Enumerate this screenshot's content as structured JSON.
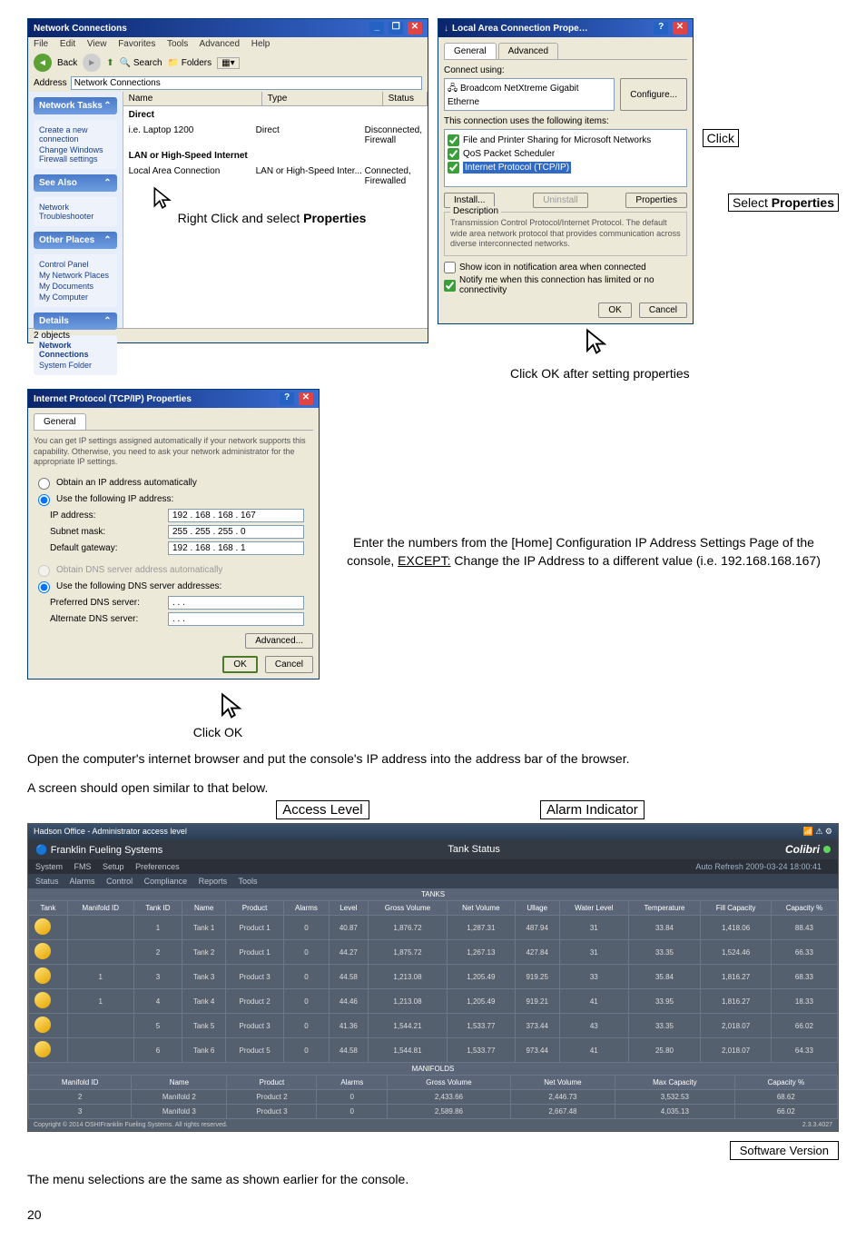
{
  "nc_window": {
    "title": "Network Connections",
    "menu": [
      "File",
      "Edit",
      "View",
      "Favorites",
      "Tools",
      "Advanced",
      "Help"
    ],
    "toolbar": {
      "back": "Back",
      "search": "Search",
      "folders": "Folders"
    },
    "address_label": "Address",
    "address_value": "Network Connections",
    "sidebar": {
      "tasks_title": "Network Tasks",
      "tasks": [
        "Create a new connection",
        "Change Windows Firewall settings"
      ],
      "seealso_title": "See Also",
      "seealso": [
        "Network Troubleshooter"
      ],
      "other_title": "Other Places",
      "other": [
        "Control Panel",
        "My Network Places",
        "My Documents",
        "My Computer"
      ],
      "details_title": "Details",
      "details": [
        "Network Connections",
        "System Folder"
      ]
    },
    "cols": [
      "Name",
      "Type",
      "Status"
    ],
    "group1": "Direct",
    "row1": {
      "name": "i.e. Laptop 1200",
      "type": "Direct",
      "status": "Disconnected, Firewall"
    },
    "group2": "LAN or High-Speed Internet",
    "row2": {
      "name": "Local Area Connection",
      "type": "LAN or High-Speed Inter...",
      "status": "Connected, Firewalled"
    },
    "status": "2 objects"
  },
  "annot": {
    "right_click": "Right Click and select ",
    "prop_bold": "Properties",
    "click": "Click",
    "select_prop": "Select ",
    "click_ok_after": "Click OK after setting properties",
    "click_ok": "Click OK",
    "enter_para": "Enter the numbers from the [Home] Configuration IP Address Settings Page of the console, ",
    "except": "EXCEPT:",
    "enter_para2": " Change the IP Address to a different value (i.e. 192.168.168.167)"
  },
  "props": {
    "title": "Local Area Connection Prope…",
    "tab_general": "General",
    "tab_adv": "Advanced",
    "connect_using_label": "Connect using:",
    "adapter": "Broadcom NetXtreme Gigabit Etherne",
    "configure": "Configure...",
    "uses_label": "This connection uses the following items:",
    "item1": "File and Printer Sharing for Microsoft Networks",
    "item2": "QoS Packet Scheduler",
    "item3": "Internet Protocol (TCP/IP)",
    "install": "Install...",
    "uninstall": "Uninstall",
    "properties": "Properties",
    "desc_head": "Description",
    "desc": "Transmission Control Protocol/Internet Protocol. The default wide area network protocol that provides communication across diverse interconnected networks.",
    "chk1": "Show icon in notification area when connected",
    "chk2": "Notify me when this connection has limited or no connectivity",
    "ok": "OK",
    "cancel": "Cancel"
  },
  "tcpip": {
    "title": "Internet Protocol (TCP/IP) Properties",
    "tab": "General",
    "intro": "You can get IP settings assigned automatically if your network supports this capability. Otherwise, you need to ask your network administrator for the appropriate IP settings.",
    "r1": "Obtain an IP address automatically",
    "r2": "Use the following IP address:",
    "ip_label": "IP address:",
    "ip": "192 . 168 . 168 . 167",
    "mask_label": "Subnet mask:",
    "mask": "255 . 255 . 255 . 0",
    "gate_label": "Default gateway:",
    "gate": "192 . 168 . 168 . 1",
    "r3": "Obtain DNS server address automatically",
    "r4": "Use the following DNS server addresses:",
    "pdns": "Preferred DNS server:",
    "pdns_v": " .   .   . ",
    "adns": "Alternate DNS server:",
    "adns_v": " .   .   . ",
    "adv": "Advanced...",
    "ok": "OK",
    "cancel": "Cancel"
  },
  "body_text": {
    "p1": "Open the computer's internet browser and put the console's IP address into the address bar of the browser.",
    "p2": "A screen should open similar to that below.",
    "p3": "The menu selections are the same as shown earlier for the console.",
    "access": "Access Level",
    "alarm": "Alarm Indicator",
    "sv": "Software Version",
    "page": "20"
  },
  "web": {
    "hdr_left": "Franklin Fueling Systems",
    "hdr_right": "Tank Status",
    "brand": "Colibri",
    "user_line": "Hadson Office - Administrator access level",
    "right_info": "Auto Refresh  2009-03-24 18:00:41",
    "menu": [
      "System",
      "FMS",
      "Setup",
      "Preferences"
    ],
    "submenu": [
      "Status",
      "Alarms",
      "Control",
      "Compliance",
      "Reports",
      "Tools"
    ],
    "tanks_title": "TANKS",
    "cols": [
      "Tank",
      "Manifold ID",
      "Tank ID",
      "Name",
      "Product",
      "Alarms",
      "Level",
      "Gross Volume",
      "Net Volume",
      "Ullage",
      "Water Level",
      "Temperature",
      "Fill Capacity",
      "Capacity %"
    ],
    "rows": [
      [
        "",
        "",
        "1",
        "Tank 1",
        "Product 1",
        "0",
        "40.87",
        "1,876.72",
        "1,287.31",
        "487.94",
        "31",
        "33.84",
        "1,418.06",
        "88.43"
      ],
      [
        "",
        "",
        "2",
        "Tank 2",
        "Product 1",
        "0",
        "44.27",
        "1,875.72",
        "1,267.13",
        "427.84",
        "31",
        "33.35",
        "1,524.46",
        "66.33"
      ],
      [
        "",
        "1",
        "3",
        "Tank 3",
        "Product 3",
        "0",
        "44.58",
        "1,213.08",
        "1,205.49",
        "919.25",
        "33",
        "35.84",
        "1,816.27",
        "68.33"
      ],
      [
        "",
        "1",
        "4",
        "Tank 4",
        "Product 2",
        "0",
        "44.46",
        "1,213.08",
        "1,205.49",
        "919.21",
        "41",
        "33.95",
        "1,816.27",
        "18.33"
      ],
      [
        "",
        "",
        "5",
        "Tank 5",
        "Product 3",
        "0",
        "41.36",
        "1,544.21",
        "1,533.77",
        "373.44",
        "43",
        "33.35",
        "2,018.07",
        "66.02"
      ],
      [
        "",
        "",
        "6",
        "Tank 6",
        "Product 5",
        "0",
        "44.58",
        "1,544.81",
        "1,533.77",
        "973.44",
        "41",
        "25.80",
        "2,018.07",
        "64.33"
      ]
    ],
    "man_title": "MANIFOLDS",
    "man_cols": [
      "Manifold ID",
      "Name",
      "Product",
      "Alarms",
      "Gross Volume",
      "Net Volume",
      "Max Capacity",
      "Capacity %"
    ],
    "man_rows": [
      [
        "2",
        "Manifold 2",
        "Product 2",
        "0",
        "2,433.66",
        "2,446.73",
        "3,532.53",
        "68.62"
      ],
      [
        "3",
        "Manifold 3",
        "Product 3",
        "0",
        "2,589.86",
        "2,667.48",
        "4,035.13",
        "66.02"
      ]
    ],
    "copyright": "Copyright © 2014 OSHIFranklin Fueling Systems. All rights reserved.",
    "version": "2.3.3.4027"
  }
}
